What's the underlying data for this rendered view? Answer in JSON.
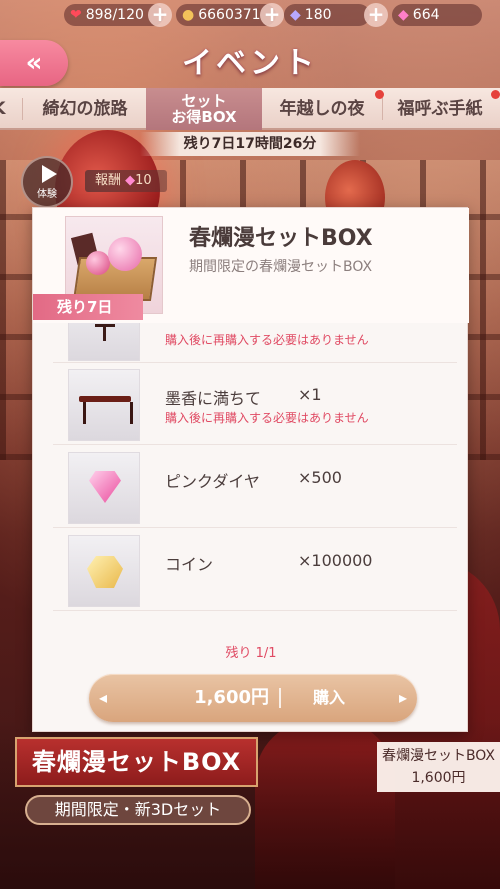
{
  "status": {
    "stamina": "898/120",
    "coins": "6660371",
    "diamonds_blue": "180",
    "diamonds_pink": "664"
  },
  "header": {
    "title": "イベント",
    "back_icon": "double-chevron-left-icon"
  },
  "tabs": [
    {
      "label": "綺幻の旅路",
      "active": false
    },
    {
      "label": "セット",
      "label2": "お得BOX",
      "active": true
    },
    {
      "label": "年越しの夜",
      "active": false
    },
    {
      "label": "福呼ぶ手紙",
      "active": false
    }
  ],
  "countdown": "残り7日17時間26分",
  "experience_label": "体験",
  "reward": {
    "label": "報酬",
    "value": "10"
  },
  "panel": {
    "title": "春爛漫セットBOX",
    "subtitle": "期間限定の春爛漫セットBOX",
    "days_left": "残り7日",
    "items": [
      {
        "name": "",
        "qty": "",
        "note": "購入後に再購入する必要はありません",
        "icon": "stand-icon"
      },
      {
        "name": "墨香に満ちて",
        "qty": "×1",
        "note": "購入後に再購入する必要はありません",
        "icon": "table-icon"
      },
      {
        "name": "ピンクダイヤ",
        "qty": "×500",
        "note": "",
        "icon": "pink-diamond-icon"
      },
      {
        "name": "コイン",
        "qty": "×100000",
        "note": "",
        "icon": "coin-icon"
      }
    ],
    "remaining": "残り 1/1",
    "buy": {
      "price": "1,600円",
      "label": "購入"
    }
  },
  "banner": {
    "title": "春爛漫セットBOX",
    "subtitle": "期間限定・新3Dセット"
  },
  "side_card": {
    "title": "春爛漫セットBOX",
    "price": "1,600円"
  },
  "colors": {
    "accent_pink": "#e86583",
    "note_red": "#e04a63",
    "gold": "#d9a57d"
  }
}
